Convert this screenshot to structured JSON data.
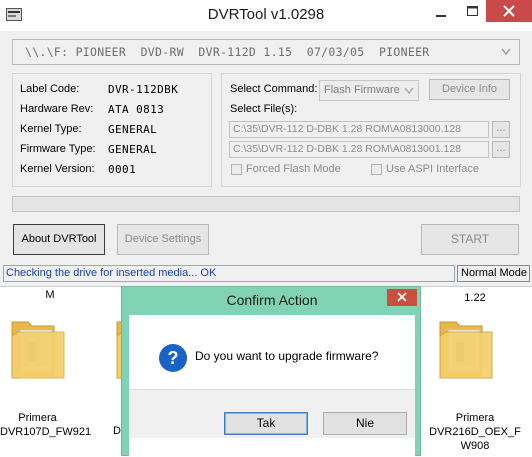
{
  "window": {
    "title": "DVRTool v1.0298",
    "device_line": "\\\\.\\F: PIONEER  DVD-RW  DVR-112D 1.15  07/03/05  PIONEER"
  },
  "info": {
    "label_code": {
      "label": "Label Code:",
      "value": "DVR-112DBK"
    },
    "hardware_rev": {
      "label": "Hardware Rev:",
      "value": "ATA 0813"
    },
    "kernel_type": {
      "label": "Kernel Type:",
      "value": "GENERAL"
    },
    "firmware_type": {
      "label": "Firmware Type:",
      "value": "GENERAL"
    },
    "kernel_version": {
      "label": "Kernel Version:",
      "value": "0001"
    }
  },
  "command": {
    "select_command_label": "Select Command:",
    "select_command_value": "Flash Firmware",
    "device_info_label": "Device Info",
    "select_files_label": "Select File(s):",
    "file1": "C:\\35\\DVR-112 D-DBK 1.28 ROM\\A0813000.128",
    "file2": "C:\\35\\DVR-112 D-DBK 1.28 ROM\\A0813001.128",
    "browse_label": "...",
    "forced_flash_label": "Forced Flash Mode",
    "use_aspi_label": "Use ASPI Interface"
  },
  "progress": 0,
  "buttons": {
    "about": "About DVRTool",
    "device_settings": "Device Settings",
    "start": "START"
  },
  "status": {
    "text": "Checking the drive for inserted media... OK",
    "mode": "Normal Mode"
  },
  "desktop": {
    "top_left_fragment": "M",
    "top_right_fragment": "1.22",
    "left_folder": {
      "line1": "Primera",
      "line2": "DVR107D_FW921"
    },
    "left_partial": "D",
    "right_folder": {
      "line1": "Primera",
      "line2": "DVR216D_OEX_F",
      "line3": "W908"
    }
  },
  "dialog": {
    "title": "Confirm Action",
    "message": "Do you want to upgrade firmware?",
    "yes_label": "Tak",
    "no_label": "Nie"
  }
}
